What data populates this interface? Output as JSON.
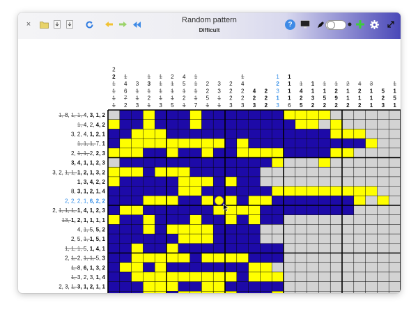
{
  "window": {
    "title": "Random pattern",
    "subtitle": "Difficult"
  },
  "toolbar": {
    "close": "×",
    "icons": [
      "close-icon",
      "folder-open-icon",
      "download-icon",
      "save-icon",
      "refresh-icon",
      "undo-icon",
      "redo-icon",
      "rewind-icon",
      "help-icon",
      "monitor-icon",
      "pencil-icon",
      "toggle-switch",
      "moon-icon",
      "add-icon",
      "gear-icon",
      "expand-icon"
    ],
    "help": "?"
  },
  "colors": {
    "filled": "#1d0aa8",
    "cross": "#ffff00",
    "unknown": "#d3d3d3",
    "grid": "#000000",
    "highlight": "#2f8be6",
    "accent": "#4a48b8"
  },
  "grid_size": {
    "rows": 20,
    "cols": 20
  },
  "cursor_cell": {
    "row": 9,
    "col": 9
  },
  "row_clues": [
    [
      [
        "1",
        "s"
      ],
      [
        "8",
        "n"
      ],
      [
        "1",
        "s"
      ],
      [
        "1",
        "s"
      ],
      [
        "4",
        "n"
      ],
      [
        "3",
        "b"
      ],
      [
        "1",
        "b"
      ],
      [
        "2",
        "b"
      ]
    ],
    [
      [
        "1",
        "s"
      ],
      [
        "4",
        "n"
      ],
      [
        "2",
        "n"
      ],
      [
        "4",
        "b"
      ],
      [
        "2",
        "b"
      ]
    ],
    [
      [
        "3",
        "n"
      ],
      [
        "2",
        "n"
      ],
      [
        "4",
        "n"
      ],
      [
        "1",
        "b"
      ],
      [
        "2",
        "b"
      ],
      [
        "1",
        "b"
      ]
    ],
    [
      [
        "1",
        "s"
      ],
      [
        "1",
        "s"
      ],
      [
        "1",
        "s"
      ],
      [
        "7",
        "n"
      ],
      [
        "1",
        "b"
      ]
    ],
    [
      [
        "2",
        "n"
      ],
      [
        "1",
        "s"
      ],
      [
        "1",
        "s"
      ],
      [
        "2",
        "n"
      ],
      [
        "2",
        "b"
      ],
      [
        "3",
        "b"
      ]
    ],
    [
      [
        "3",
        "b"
      ],
      [
        "4",
        "b"
      ],
      [
        "1",
        "b"
      ],
      [
        "1",
        "b"
      ],
      [
        "2",
        "b"
      ],
      [
        "3",
        "b"
      ]
    ],
    [
      [
        "3",
        "n"
      ],
      [
        "2",
        "n"
      ],
      [
        "1",
        "s"
      ],
      [
        "1",
        "s"
      ],
      [
        "1",
        "b"
      ],
      [
        "2",
        "b"
      ],
      [
        "1",
        "b"
      ],
      [
        "3",
        "b"
      ],
      [
        "2",
        "b"
      ]
    ],
    [
      [
        "1",
        "b"
      ],
      [
        "3",
        "b"
      ],
      [
        "4",
        "b"
      ],
      [
        "2",
        "b"
      ],
      [
        "2",
        "b"
      ]
    ],
    [
      [
        "8",
        "n"
      ],
      [
        "3",
        "b"
      ],
      [
        "1",
        "b"
      ],
      [
        "2",
        "b"
      ],
      [
        "1",
        "b"
      ],
      [
        "4",
        "b"
      ]
    ],
    [
      [
        "2",
        "h"
      ],
      [
        "2",
        "h"
      ],
      [
        "2",
        "h"
      ],
      [
        "1",
        "h"
      ],
      [
        "6",
        "hb"
      ],
      [
        "2",
        "hb"
      ],
      [
        "2",
        "hb"
      ]
    ],
    [
      [
        "2",
        "n"
      ],
      [
        "1",
        "s"
      ],
      [
        "1",
        "s"
      ],
      [
        "1",
        "s"
      ],
      [
        "1",
        "b"
      ],
      [
        "4",
        "b"
      ],
      [
        "1",
        "b"
      ],
      [
        "2",
        "b"
      ],
      [
        "3",
        "b"
      ]
    ],
    [
      [
        "13",
        "s"
      ],
      [
        "1",
        "b"
      ],
      [
        "2",
        "b"
      ],
      [
        "1",
        "b"
      ],
      [
        "1",
        "b"
      ],
      [
        "1",
        "b"
      ],
      [
        "1",
        "b"
      ]
    ],
    [
      [
        "4",
        "n"
      ],
      [
        "1",
        "s"
      ],
      [
        "5",
        "n"
      ],
      [
        "5",
        "b"
      ],
      [
        "2",
        "b"
      ]
    ],
    [
      [
        "2",
        "n"
      ],
      [
        "5",
        "n"
      ],
      [
        "1",
        "s"
      ],
      [
        "1",
        "b"
      ],
      [
        "5",
        "b"
      ],
      [
        "1",
        "b"
      ]
    ],
    [
      [
        "1",
        "s"
      ],
      [
        "1",
        "s"
      ],
      [
        "1",
        "s"
      ],
      [
        "5",
        "n"
      ],
      [
        "1",
        "b"
      ],
      [
        "4",
        "b"
      ],
      [
        "1",
        "b"
      ]
    ],
    [
      [
        "2",
        "n"
      ],
      [
        "1",
        "s"
      ],
      [
        "2",
        "n"
      ],
      [
        "1",
        "s"
      ],
      [
        "1",
        "s"
      ],
      [
        "5",
        "n"
      ],
      [
        "3",
        "b"
      ]
    ],
    [
      [
        "1",
        "s"
      ],
      [
        "8",
        "n"
      ],
      [
        "6",
        "b"
      ],
      [
        "1",
        "b"
      ],
      [
        "3",
        "b"
      ],
      [
        "2",
        "b"
      ]
    ],
    [
      [
        "1",
        "s"
      ],
      [
        "3",
        "n"
      ],
      [
        "2",
        "n"
      ],
      [
        "3",
        "n"
      ],
      [
        "1",
        "b"
      ],
      [
        "4",
        "b"
      ]
    ],
    [
      [
        "2",
        "n"
      ],
      [
        "3",
        "n"
      ],
      [
        "1",
        "s"
      ],
      [
        "3",
        "b"
      ],
      [
        "1",
        "b"
      ],
      [
        "2",
        "b"
      ],
      [
        "1",
        "b"
      ],
      [
        "1",
        "b"
      ]
    ],
    [
      [
        "4",
        "n"
      ],
      [
        "2",
        "n"
      ],
      [
        "1",
        "s"
      ],
      [
        "2",
        "n"
      ],
      [
        "1",
        "b"
      ],
      [
        "1",
        "b"
      ],
      [
        "1",
        "b"
      ],
      [
        "2",
        "b"
      ]
    ]
  ],
  "col_clues": [
    [
      [
        "2",
        "n"
      ],
      [
        "2",
        "b"
      ],
      [
        "1",
        "s"
      ],
      [
        "1",
        "s"
      ],
      [
        "1",
        "s"
      ],
      [
        "1",
        "s"
      ]
    ],
    [
      [
        "1",
        "s"
      ],
      [
        "4",
        "n"
      ],
      [
        "6",
        "n"
      ],
      [
        "7",
        "s"
      ],
      [
        "2",
        "n"
      ]
    ],
    [
      [
        "3",
        "n"
      ],
      [
        "1",
        "s"
      ],
      [
        "1",
        "s"
      ],
      [
        "3",
        "n"
      ]
    ],
    [
      [
        "1",
        "s"
      ],
      [
        "3",
        "b"
      ],
      [
        "1",
        "s"
      ],
      [
        "2",
        "n"
      ],
      [
        "1",
        "s"
      ]
    ],
    [
      [
        "1",
        "s"
      ],
      [
        "1",
        "s"
      ],
      [
        "1",
        "s"
      ],
      [
        "1",
        "s"
      ],
      [
        "3",
        "n"
      ]
    ],
    [
      [
        "2",
        "n"
      ],
      [
        "1",
        "s"
      ],
      [
        "1",
        "s"
      ],
      [
        "1",
        "s"
      ],
      [
        "5",
        "n"
      ]
    ],
    [
      [
        "4",
        "n"
      ],
      [
        "5",
        "n"
      ],
      [
        "1",
        "s"
      ],
      [
        "2",
        "n"
      ],
      [
        "1",
        "s"
      ]
    ],
    [
      [
        "1",
        "s"
      ],
      [
        "1",
        "s"
      ],
      [
        "1",
        "s"
      ],
      [
        "1",
        "s"
      ],
      [
        "7",
        "n"
      ]
    ],
    [
      [
        "2",
        "n"
      ],
      [
        "2",
        "n"
      ],
      [
        "5",
        "n"
      ],
      [
        "1",
        "s"
      ]
    ],
    [
      [
        "3",
        "n"
      ],
      [
        "3",
        "n"
      ],
      [
        "1",
        "s"
      ],
      [
        "1",
        "s"
      ]
    ],
    [
      [
        "2",
        "n"
      ],
      [
        "2",
        "n"
      ],
      [
        "2",
        "n"
      ],
      [
        "3",
        "n"
      ]
    ],
    [
      [
        "1",
        "s"
      ],
      [
        "4",
        "n"
      ],
      [
        "2",
        "n"
      ],
      [
        "2",
        "n"
      ],
      [
        "3",
        "n"
      ]
    ],
    [
      [
        "4",
        "b"
      ],
      [
        "2",
        "b"
      ],
      [
        "3",
        "b"
      ]
    ],
    [
      [
        "2",
        "b"
      ],
      [
        "2",
        "b"
      ],
      [
        "2",
        "b"
      ]
    ],
    [
      [
        "1",
        "h"
      ],
      [
        "2",
        "hb"
      ],
      [
        "3",
        "h"
      ],
      [
        "1",
        "hb"
      ],
      [
        "3",
        "h"
      ]
    ],
    [
      [
        "1",
        "b"
      ],
      [
        "1",
        "b"
      ],
      [
        "1",
        "b"
      ],
      [
        "1",
        "b"
      ],
      [
        "6",
        "n"
      ]
    ],
    [
      [
        "1",
        "s"
      ],
      [
        "4",
        "b"
      ],
      [
        "2",
        "b"
      ],
      [
        "5",
        "b"
      ]
    ],
    [
      [
        "1",
        "b"
      ],
      [
        "1",
        "b"
      ],
      [
        "3",
        "b"
      ],
      [
        "2",
        "b"
      ]
    ],
    [
      [
        "1",
        "s"
      ],
      [
        "1",
        "b"
      ],
      [
        "5",
        "b"
      ],
      [
        "2",
        "b"
      ]
    ],
    [
      [
        "1",
        "s"
      ],
      [
        "2",
        "b"
      ],
      [
        "9",
        "b"
      ],
      [
        "2",
        "b"
      ]
    ],
    [
      [
        "2",
        "s"
      ],
      [
        "1",
        "b"
      ],
      [
        "1",
        "b"
      ],
      [
        "2",
        "b"
      ]
    ],
    [
      [
        "4",
        "s"
      ],
      [
        "2",
        "b"
      ],
      [
        "1",
        "b"
      ],
      [
        "2",
        "b"
      ]
    ],
    [
      [
        "3",
        "s"
      ],
      [
        "1",
        "b"
      ],
      [
        "1",
        "b"
      ],
      [
        "1",
        "b"
      ]
    ],
    [
      [
        "5",
        "b"
      ],
      [
        "2",
        "b"
      ],
      [
        "3",
        "b"
      ]
    ],
    [
      [
        "1",
        "s"
      ],
      [
        "1",
        "b"
      ],
      [
        "5",
        "b"
      ],
      [
        "1",
        "b"
      ]
    ],
    [
      [
        "5",
        "b"
      ],
      [
        "2",
        "b"
      ],
      [
        "1",
        "b"
      ],
      [
        "4",
        "b"
      ]
    ],
    [
      [
        "1",
        "b"
      ],
      [
        "2",
        "b"
      ],
      [
        "2",
        "b"
      ],
      [
        "7",
        "b"
      ],
      [
        "2",
        "b"
      ],
      [
        "3",
        "b"
      ]
    ],
    [
      [
        "2",
        "b"
      ],
      [
        "1",
        "b"
      ],
      [
        "1",
        "b"
      ],
      [
        "2",
        "b"
      ]
    ],
    [
      [
        "1",
        "b"
      ],
      [
        "3",
        "b"
      ],
      [
        "2",
        "b"
      ],
      [
        "1",
        "b"
      ]
    ],
    [
      [
        "1",
        "b"
      ],
      [
        "1",
        "b"
      ],
      [
        "3",
        "b"
      ],
      [
        "2",
        "b"
      ],
      [
        "1",
        "b"
      ]
    ],
    [
      [
        "1",
        "b"
      ],
      [
        "1",
        "b"
      ],
      [
        "2",
        "b"
      ],
      [
        "2",
        "b"
      ],
      [
        "1",
        "b"
      ]
    ]
  ],
  "cells": [
    "XFFYFFFYFFFFFFFYYYYUUUUUU",
    "YFFYFFFYFFFFFFFFYYUYUUUUU",
    "FFYYYFFFFFFFFFFFFFFYYYUUU",
    "FYYYYYYYYYFYFFFFFFFFFFYUU",
    "YYYFFYFFYFFYYYYFFFFYYUUUUU",
    "XFFFFFFFFFFFFFYUUUYUUUUUUU",
    "YYYFYYYFFFFFFUUUUUUUUUUUUU",
    "YFFFFFYYYFYFFUUUUUUUUUUUUU",
    "FFFFFFYYFFFFFFYYYYYYYYYUUU",
    "FFFYYYFFYFYFYYFFFFFFFYUYU",
    "FYYFFFFFFYYYYFFFFFFFFUUUUU",
    "YFFYFFFYFFYFYFFUUUUUUUUUUU",
    "FFFYFYYYYFFFFUUUUUUUUUUUUU",
    "FFFFFFYYYFFFFUUUUUUUUUUUUU",
    "FFYFFYFFFFFFFFFUUUUUUUUUUU",
    "FFYYYYYFYYYYFFFUUUUUUUUUUU",
    "FYYFYFFFFFFFYYUUUUUUUUUUUU",
    "FFYYYYYYYYYFYYYUUUUUUUUUUU",
    "FFFYYYFFYYFFFFFUUUUUUUUUUU",
    "FFFYYFYYYYYFFFYUUUUUUUUUUU"
  ]
}
